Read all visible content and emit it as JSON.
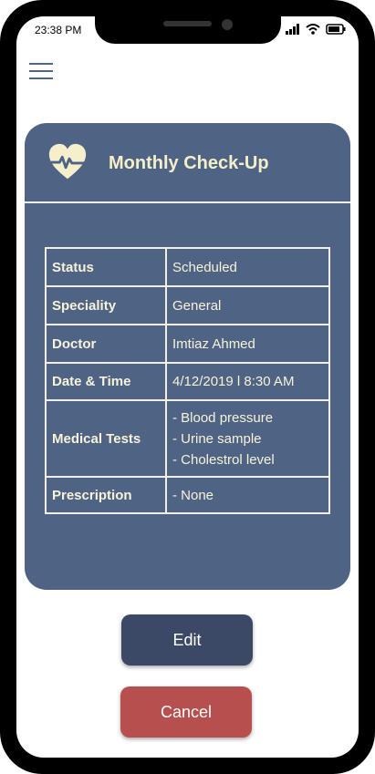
{
  "status_bar": {
    "time": "23:38 PM"
  },
  "menu": {
    "icon": "hamburger-menu-icon"
  },
  "card": {
    "title": "Monthly Check-Up",
    "icon": "heart-pulse-icon",
    "rows": [
      {
        "label": "Status",
        "value": "Scheduled"
      },
      {
        "label": "Speciality",
        "value": "General"
      },
      {
        "label": "Doctor",
        "value": "Imtiaz Ahmed"
      },
      {
        "label": "Date & Time",
        "value": "4/12/2019 l 8:30 AM"
      },
      {
        "label": "Medical Tests",
        "values": [
          "- Blood pressure",
          "- Urine sample",
          "- Cholestrol level"
        ]
      },
      {
        "label": "Prescription",
        "value": "- None"
      }
    ]
  },
  "buttons": {
    "edit": "Edit",
    "cancel": "Cancel"
  },
  "colors": {
    "card_bg": "#4f6385",
    "edit_bg": "#3b4966",
    "cancel_bg": "#b84f4f",
    "accent_text": "#f4efc9"
  }
}
